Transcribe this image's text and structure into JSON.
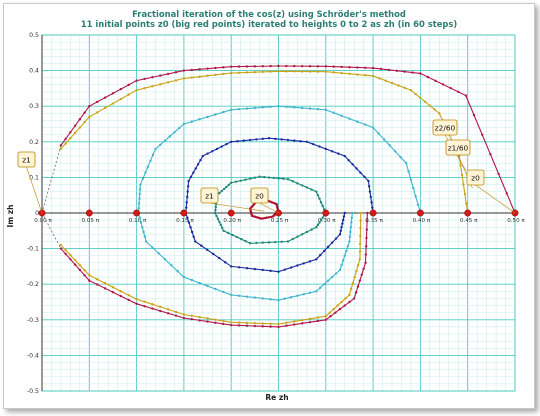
{
  "title_line1": "Fractional iteration of the cos(z) using Schröder's method",
  "title_line2": "11 initial points z0 (big red points) iterated to heights 0 to 2 as zh (in 60 steps)",
  "chart_data": {
    "type": "scatter",
    "xlabel": "Re zh",
    "ylabel": "Im zh",
    "xlim": [
      0,
      0.5
    ],
    "x_unit": "π",
    "ylim": [
      -0.5,
      0.5
    ],
    "x_ticks": [
      0.0,
      0.05,
      0.1,
      0.15,
      0.2,
      0.25,
      0.3,
      0.35,
      0.4,
      0.45,
      0.5
    ],
    "x_tick_labels": [
      "0.00 π",
      "0.05 π",
      "0.10 π",
      "0.15 π",
      "0.20 π",
      "0.25 π",
      "0.30 π",
      "0.35 π",
      "0.40 π",
      "0.45 π",
      "0.50 π"
    ],
    "y_ticks": [
      -0.5,
      -0.4,
      -0.3,
      -0.2,
      -0.1,
      0,
      0.1,
      0.2,
      0.3,
      0.4,
      0.5
    ],
    "y_tick_labels": [
      "-0.5",
      "-0.4",
      "-0.3",
      "-0.2",
      "-0.1",
      "0",
      "0.1",
      "0.2",
      "0.3",
      "0.4",
      "0.5"
    ],
    "grid": true,
    "fixed_point_x": 0.235,
    "initial_points": [
      {
        "x": 0.0,
        "y": 0
      },
      {
        "x": 0.05,
        "y": 0
      },
      {
        "x": 0.1,
        "y": 0
      },
      {
        "x": 0.15,
        "y": 0
      },
      {
        "x": 0.2,
        "y": 0
      },
      {
        "x": 0.25,
        "y": 0
      },
      {
        "x": 0.3,
        "y": 0
      },
      {
        "x": 0.35,
        "y": 0
      },
      {
        "x": 0.4,
        "y": 0
      },
      {
        "x": 0.45,
        "y": 0
      },
      {
        "x": 0.5,
        "y": 0
      }
    ],
    "series": [
      {
        "x0": 0.5,
        "color": "#b0174a",
        "upper_arc": [
          [
            0.5,
            0.0
          ],
          [
            0.448,
            0.33
          ],
          [
            0.4,
            0.392
          ],
          [
            0.35,
            0.407
          ],
          [
            0.3,
            0.412
          ],
          [
            0.25,
            0.413
          ],
          [
            0.2,
            0.411
          ],
          [
            0.15,
            0.4
          ],
          [
            0.1,
            0.372
          ],
          [
            0.05,
            0.3
          ],
          [
            0.02,
            0.19
          ]
        ],
        "lower_arc": [
          [
            0.02,
            -0.1
          ],
          [
            0.05,
            -0.19
          ],
          [
            0.1,
            -0.255
          ],
          [
            0.15,
            -0.295
          ],
          [
            0.2,
            -0.315
          ],
          [
            0.25,
            -0.32
          ],
          [
            0.3,
            -0.3
          ],
          [
            0.33,
            -0.24
          ],
          [
            0.342,
            -0.14
          ],
          [
            0.344,
            0.0
          ]
        ]
      },
      {
        "x0": 0.45,
        "color": "#c9a418",
        "upper_arc": [
          [
            0.45,
            0.0
          ],
          [
            0.441,
            0.16
          ],
          [
            0.42,
            0.28
          ],
          [
            0.39,
            0.345
          ],
          [
            0.35,
            0.385
          ],
          [
            0.3,
            0.397
          ],
          [
            0.25,
            0.398
          ],
          [
            0.2,
            0.393
          ],
          [
            0.15,
            0.378
          ],
          [
            0.1,
            0.345
          ],
          [
            0.05,
            0.27
          ],
          [
            0.02,
            0.18
          ]
        ],
        "lower_arc": [
          [
            0.02,
            -0.09
          ],
          [
            0.05,
            -0.175
          ],
          [
            0.1,
            -0.242
          ],
          [
            0.15,
            -0.285
          ],
          [
            0.2,
            -0.307
          ],
          [
            0.25,
            -0.312
          ],
          [
            0.3,
            -0.29
          ],
          [
            0.325,
            -0.23
          ],
          [
            0.336,
            -0.13
          ],
          [
            0.337,
            0.0
          ]
        ]
      },
      {
        "x0": 0.4,
        "color": "#3fb6cf",
        "upper_arc": [
          [
            0.4,
            0.0
          ],
          [
            0.385,
            0.14
          ],
          [
            0.35,
            0.24
          ],
          [
            0.3,
            0.29
          ],
          [
            0.25,
            0.3
          ],
          [
            0.2,
            0.29
          ],
          [
            0.15,
            0.25
          ],
          [
            0.12,
            0.18
          ],
          [
            0.104,
            0.08
          ],
          [
            0.102,
            0.0
          ]
        ],
        "lower_arc": [
          [
            0.102,
            0.0
          ],
          [
            0.11,
            -0.08
          ],
          [
            0.15,
            -0.18
          ],
          [
            0.2,
            -0.23
          ],
          [
            0.25,
            -0.245
          ],
          [
            0.29,
            -0.22
          ],
          [
            0.315,
            -0.16
          ],
          [
            0.325,
            -0.08
          ],
          [
            0.328,
            0.0
          ]
        ]
      },
      {
        "x0": 0.35,
        "color": "#1a2a9e",
        "upper_arc": [
          [
            0.35,
            0.0
          ],
          [
            0.345,
            0.09
          ],
          [
            0.32,
            0.16
          ],
          [
            0.28,
            0.2
          ],
          [
            0.24,
            0.21
          ],
          [
            0.2,
            0.2
          ],
          [
            0.17,
            0.16
          ],
          [
            0.155,
            0.09
          ],
          [
            0.152,
            0.0
          ]
        ],
        "lower_arc": [
          [
            0.152,
            0.0
          ],
          [
            0.162,
            -0.08
          ],
          [
            0.2,
            -0.15
          ],
          [
            0.25,
            -0.165
          ],
          [
            0.29,
            -0.13
          ],
          [
            0.315,
            -0.06
          ],
          [
            0.32,
            0.0
          ]
        ]
      },
      {
        "x0": 0.3,
        "color": "#1e8a7a",
        "upper_arc": [
          [
            0.3,
            0.0
          ],
          [
            0.29,
            0.06
          ],
          [
            0.26,
            0.095
          ],
          [
            0.23,
            0.102
          ],
          [
            0.2,
            0.085
          ],
          [
            0.185,
            0.05
          ],
          [
            0.183,
            0.0
          ]
        ],
        "lower_arc": [
          [
            0.183,
            0.0
          ],
          [
            0.192,
            -0.05
          ],
          [
            0.22,
            -0.085
          ],
          [
            0.26,
            -0.08
          ],
          [
            0.29,
            -0.04
          ],
          [
            0.3,
            0.0
          ]
        ]
      },
      {
        "x0": 0.25,
        "color": "#b0102a",
        "upper_arc": [
          [
            0.25,
            0.0
          ],
          [
            0.248,
            0.025
          ],
          [
            0.238,
            0.035
          ],
          [
            0.226,
            0.03
          ],
          [
            0.22,
            0.012
          ],
          [
            0.222,
            -0.008
          ],
          [
            0.232,
            -0.016
          ],
          [
            0.244,
            -0.01
          ],
          [
            0.248,
            0.0
          ]
        ],
        "lower_arc": []
      }
    ],
    "callouts": [
      {
        "label": "z1"
      },
      {
        "label": "z1"
      },
      {
        "label": "z0"
      },
      {
        "label": "z2/60"
      },
      {
        "label": "z1/60"
      },
      {
        "label": "z0"
      }
    ]
  }
}
